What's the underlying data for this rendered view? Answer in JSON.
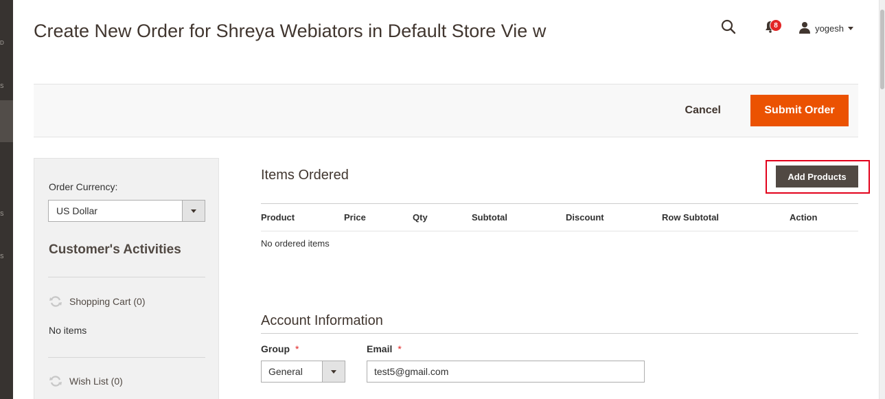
{
  "left_nav": {
    "fragments": [
      "D",
      "S",
      "S",
      "S"
    ]
  },
  "header": {
    "page_title": "Create New Order for Shreya Webiators in Default Store Vie w",
    "notifications_count": "8",
    "username": "yogesh"
  },
  "page_actions": {
    "cancel_label": "Cancel",
    "submit_label": "Submit Order"
  },
  "sidebar": {
    "order_currency_label": "Order Currency:",
    "order_currency_value": "US Dollar",
    "activities_title": "Customer's Activities",
    "shopping_cart_label": "Shopping Cart (0)",
    "shopping_cart_empty": "No items",
    "wish_list_label": "Wish List (0)"
  },
  "items_ordered": {
    "title": "Items Ordered",
    "add_products_label": "Add Products",
    "columns": [
      "Product",
      "Price",
      "Qty",
      "Subtotal",
      "Discount",
      "Row Subtotal",
      "Action"
    ],
    "empty_text": "No ordered items"
  },
  "account_information": {
    "title": "Account Information",
    "group_label": "Group",
    "group_value": "General",
    "email_label": "Email",
    "email_value": "test5@gmail.com",
    "required_mark": "*"
  },
  "colors": {
    "accent_orange": "#eb5202",
    "dark_button": "#514943",
    "highlight_outline": "#e2001a",
    "badge_red": "#e22626"
  },
  "icons": [
    "search-icon",
    "bell-icon",
    "user-icon",
    "caret-down-icon",
    "refresh-icon"
  ]
}
